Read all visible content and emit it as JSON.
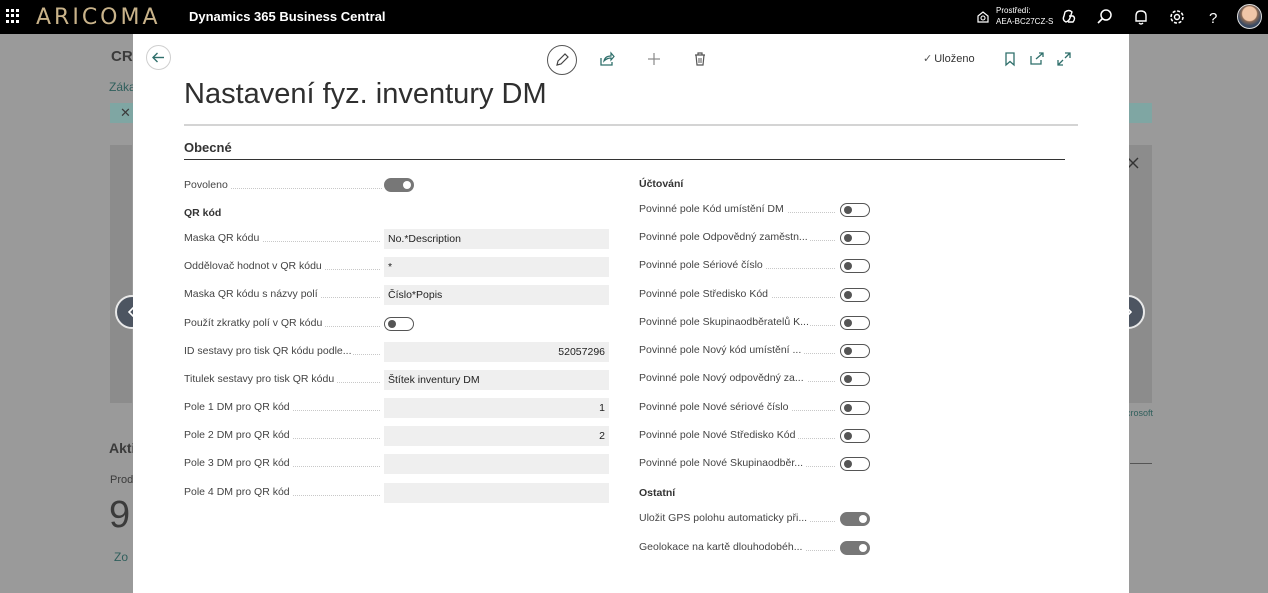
{
  "topbar": {
    "logo": "ARICOMA",
    "app_title": "Dynamics 365 Business Central",
    "env_label": "Prostředí:",
    "env_value": "AEA-BC27CZ-S"
  },
  "background": {
    "title_fragment": "CRO",
    "link_fragment": "Záka",
    "activities_fragment": "Akti",
    "prod_fragment": "Prod",
    "big_number_fragment": "9",
    "more_link_fragment": "Zo",
    "microsoft_fragment": "crosoft"
  },
  "dialog": {
    "saved_label": "Uloženo",
    "page_title": "Nastavení fyz. inventury DM",
    "section_title": "Obecné",
    "left": {
      "enabled_label": "Povoleno",
      "enabled_on": true,
      "qr_group": "QR kód",
      "fields": [
        {
          "label": "Maska QR kódu",
          "value": "No.*Description",
          "type": "text"
        },
        {
          "label": "Oddělovač hodnot v QR kódu",
          "value": "*",
          "type": "text"
        },
        {
          "label": "Maska QR kódu s názvy polí",
          "value": "Číslo*Popis",
          "type": "text"
        },
        {
          "label": "Použít zkratky polí v QR kódu",
          "value": false,
          "type": "toggle"
        },
        {
          "label": "ID sestavy pro tisk QR kódu podle...",
          "value": "52057296",
          "type": "num"
        },
        {
          "label": "Titulek sestavy pro tisk QR kódu",
          "value": "Štítek inventury DM",
          "type": "text"
        },
        {
          "label": "Pole 1 DM pro QR kód",
          "value": "1",
          "type": "num"
        },
        {
          "label": "Pole 2 DM pro QR kód",
          "value": "2",
          "type": "num"
        },
        {
          "label": "Pole 3 DM pro QR kód",
          "value": "",
          "type": "text"
        },
        {
          "label": "Pole 4 DM pro QR kód",
          "value": "",
          "type": "text"
        }
      ]
    },
    "right": {
      "posting_group": "Účtování",
      "posting_fields": [
        {
          "label": "Povinné pole Kód umístění DM",
          "on": false
        },
        {
          "label": "Povinné pole Odpovědný zaměstn...",
          "on": false
        },
        {
          "label": "Povinné pole Sériové číslo",
          "on": false
        },
        {
          "label": "Povinné pole Středisko Kód",
          "on": false
        },
        {
          "label": "Povinné pole Skupinaodběratelů K...",
          "on": false
        },
        {
          "label": "Povinné pole Nový kód umístění ...",
          "on": false
        },
        {
          "label": "Povinné pole Nový odpovědný za...",
          "on": false
        },
        {
          "label": "Povinné pole Nové sériové číslo",
          "on": false
        },
        {
          "label": "Povinné pole Nové Středisko Kód",
          "on": false
        },
        {
          "label": "Povinné pole Nové Skupinaodběr...",
          "on": false
        }
      ],
      "other_group": "Ostatní",
      "other_fields": [
        {
          "label": "Uložit GPS polohu automaticky při...",
          "on": true
        },
        {
          "label": "Geolokace na kartě dlouhodobéh...",
          "on": true
        }
      ]
    }
  },
  "icons": {
    "waffle": "app-launcher-icon",
    "environment": "environment-icon",
    "copilot": "copilot-icon",
    "search": "search-icon",
    "bell": "notifications-icon",
    "settings": "gear-icon",
    "help": "help-icon",
    "back": "back-arrow-icon",
    "edit": "pencil-icon",
    "share": "share-icon",
    "new": "plus-icon",
    "delete": "trash-icon",
    "bookmark": "bookmark-icon",
    "open_new": "open-in-new-window-icon",
    "expand": "expand-icon",
    "prev": "chevron-left-icon",
    "next": "chevron-right-icon"
  }
}
